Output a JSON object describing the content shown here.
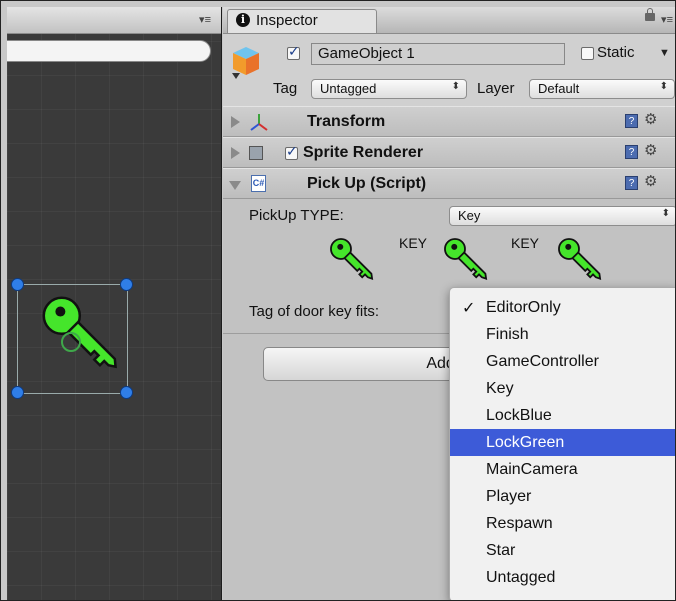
{
  "scene": {
    "menu_icon": "panel-menu-icon"
  },
  "inspector": {
    "tab_label": "Inspector",
    "gameobject": {
      "active_checked": true,
      "name": "GameObject 1",
      "static_label": "Static",
      "tag_label": "Tag",
      "tag_value": "Untagged",
      "layer_label": "Layer",
      "layer_value": "Default"
    },
    "components": [
      {
        "title": "Transform",
        "icon": "transform-axes-icon"
      },
      {
        "title": "Sprite Renderer",
        "icon": "sprite-renderer-icon",
        "enabled": true
      },
      {
        "title": "Pick Up (Script)",
        "icon": "csharp-script-icon",
        "expanded": true
      }
    ],
    "pickup": {
      "type_label": "PickUp TYPE:",
      "type_value": "Key",
      "key_texts": [
        "KEY",
        "KEY"
      ],
      "door_tag_label": "Tag of door key fits:"
    },
    "add_component_label": "Add Co"
  },
  "dropdown": {
    "items": [
      "EditorOnly",
      "Finish",
      "GameController",
      "Key",
      "LockBlue",
      "LockGreen",
      "MainCamera",
      "Player",
      "Respawn",
      "Star",
      "Untagged"
    ],
    "checked_item": "EditorOnly",
    "highlighted_item": "LockGreen",
    "check_mark": "✓"
  },
  "colors": {
    "key_green": "#45e52b",
    "selection_blue": "#3d5bd8",
    "handle_blue": "#2f7ee8"
  }
}
